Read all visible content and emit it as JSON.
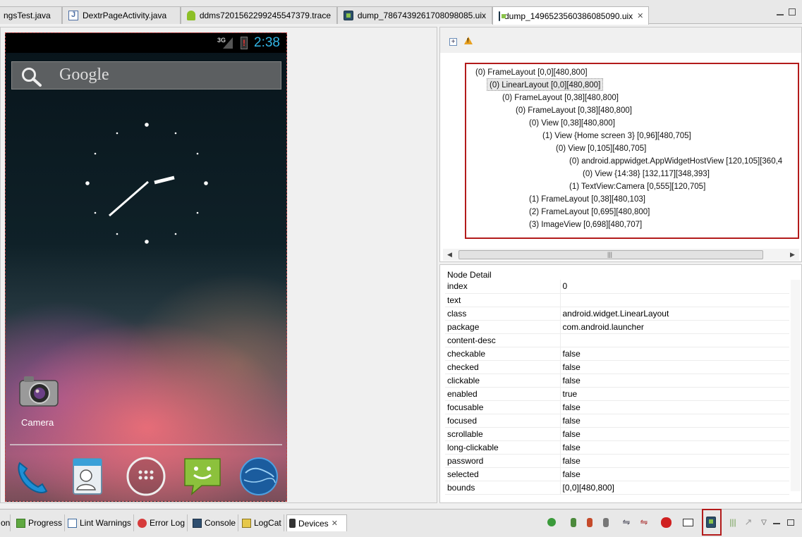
{
  "editor_tabs": [
    {
      "label": "ngsTest.java",
      "icon": "java-file-icon"
    },
    {
      "label": "DextrPageActivity.java",
      "icon": "java-file-icon"
    },
    {
      "label": "ddms7201562299245547379.trace",
      "icon": "android-icon"
    },
    {
      "label": "dump_7867439261708098085.uix",
      "icon": "uix-file-icon"
    },
    {
      "label": "dump_1496523560386085090.uix",
      "icon": "uix-file-icon",
      "active": true,
      "close": "✕"
    }
  ],
  "device": {
    "status_network": "3G",
    "status_time": "2:38",
    "search_text": "Google",
    "camera_label": "Camera"
  },
  "tree": {
    "nodes": [
      "(0) FrameLayout [0,0][480,800]",
      "(0) LinearLayout [0,0][480,800]",
      "(0) FrameLayout [0,38][480,800]",
      "(0) FrameLayout [0,38][480,800]",
      "(0) View [0,38][480,800]",
      "(1) View {Home screen 3} [0,96][480,705]",
      "(0) View [0,105][480,705]",
      "(0) android.appwidget.AppWidgetHostView [120,105][360,4",
      "(0) View {14:38} [132,117][348,393]",
      "(1) TextView:Camera [0,555][120,705]",
      "(1) FrameLayout [0,38][480,103]",
      "(2) FrameLayout [0,695][480,800]",
      "(3) ImageView [0,698][480,707]"
    ],
    "scroll_grip": "|||"
  },
  "node_detail": {
    "title": "Node Detail",
    "rows": [
      {
        "key": "index",
        "value": "0"
      },
      {
        "key": "text",
        "value": ""
      },
      {
        "key": "class",
        "value": "android.widget.LinearLayout"
      },
      {
        "key": "package",
        "value": "com.android.launcher"
      },
      {
        "key": "content-desc",
        "value": ""
      },
      {
        "key": "checkable",
        "value": "false"
      },
      {
        "key": "checked",
        "value": "false"
      },
      {
        "key": "clickable",
        "value": "false"
      },
      {
        "key": "enabled",
        "value": "true"
      },
      {
        "key": "focusable",
        "value": "false"
      },
      {
        "key": "focused",
        "value": "false"
      },
      {
        "key": "scrollable",
        "value": "false"
      },
      {
        "key": "long-clickable",
        "value": "false"
      },
      {
        "key": "password",
        "value": "false"
      },
      {
        "key": "selected",
        "value": "false"
      },
      {
        "key": "bounds",
        "value": "[0,0][480,800]"
      }
    ]
  },
  "bottom_tabs": [
    {
      "label": "on",
      "icon": "task-icon"
    },
    {
      "label": "Progress",
      "icon": "progress-icon"
    },
    {
      "label": "Lint Warnings",
      "icon": "lint-icon"
    },
    {
      "label": "Error Log",
      "icon": "error-log-icon"
    },
    {
      "label": "Console",
      "icon": "console-icon"
    },
    {
      "label": "LogCat",
      "icon": "logcat-icon"
    },
    {
      "label": "Devices",
      "icon": "devices-icon",
      "active": true,
      "close": "✕"
    }
  ],
  "colors": {
    "highlight_border": "#b31b1b",
    "status_time": "#33b5e5"
  }
}
